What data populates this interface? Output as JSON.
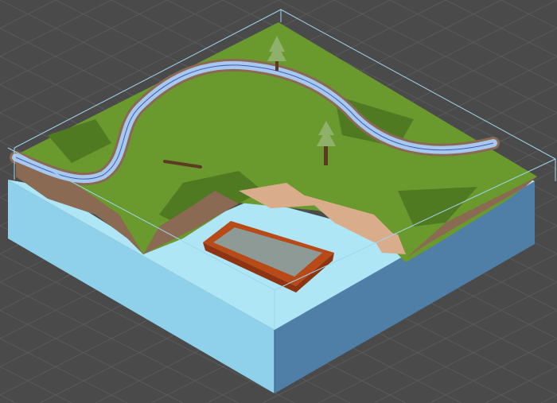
{
  "scene": {
    "view": "isometric-perspective",
    "colors": {
      "background": "#4a4a4a",
      "grid_line": "#5a5a5a",
      "grass": "#6a9a2e",
      "grass_dark": "#4f7a22",
      "dirt": "#8a6a52",
      "sand": "#d9ad8c",
      "river": "#a8c8f0",
      "water_top": "#aee6f5",
      "water_front": "#8fd0ea",
      "water_side": "#4f7fa6",
      "boat_hull": "#b84a18",
      "boat_deck": "#8d9a96",
      "tree_foliage": "#8fb06a",
      "tree_trunk": "#5b3b22",
      "selection_box": "#9fd6ee"
    },
    "objects": [
      {
        "name": "terrain-block",
        "icon": "terrain-icon"
      },
      {
        "name": "river",
        "icon": "river-icon"
      },
      {
        "name": "pine-tree-back",
        "icon": "tree-icon"
      },
      {
        "name": "pine-tree-front",
        "icon": "tree-icon"
      },
      {
        "name": "log",
        "icon": "log-icon"
      },
      {
        "name": "boat",
        "icon": "boat-icon"
      },
      {
        "name": "water-block",
        "icon": "water-icon"
      },
      {
        "name": "bounding-box",
        "icon": "bounding-box-icon"
      }
    ]
  }
}
